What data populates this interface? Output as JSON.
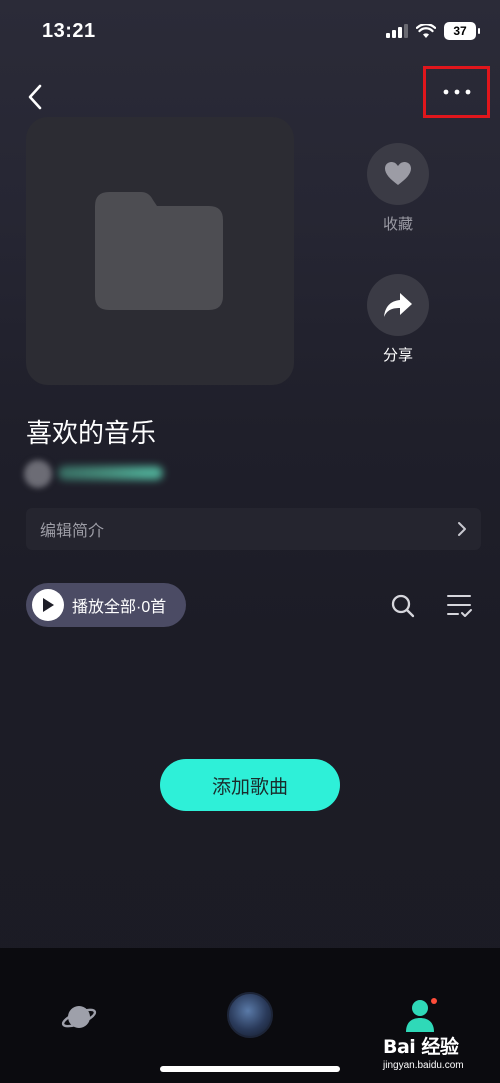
{
  "status_bar": {
    "time": "13:21",
    "battery": "37"
  },
  "header": {
    "back_icon": "chevron-left-icon",
    "more_icon": "ellipsis-icon",
    "highlight_color": "#e0161c"
  },
  "cover": {
    "icon": "folder-icon"
  },
  "actions": {
    "favorite_label": "收藏",
    "share_label": "分享"
  },
  "playlist": {
    "title": "喜欢的音乐"
  },
  "description": {
    "label": "编辑简介"
  },
  "controls": {
    "play_all_label": "播放全部·0首",
    "search_icon": "search-icon",
    "sort_icon": "sort-list-icon"
  },
  "add_song": {
    "label": "添加歌曲",
    "color": "#2ef0d8"
  },
  "tabbar": {
    "items": [
      "planet-icon",
      "now-playing-avatar",
      "profile-icon"
    ]
  },
  "watermark": {
    "main": "Bai 经验",
    "sub": "jingyan.baidu.com"
  }
}
